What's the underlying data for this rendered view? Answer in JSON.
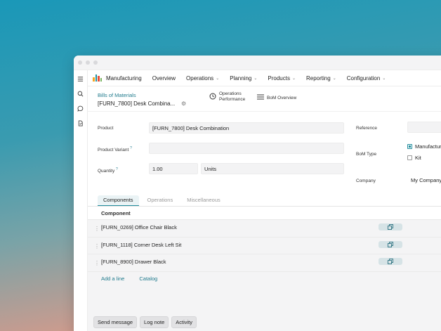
{
  "nav": {
    "app_name": "Manufacturing",
    "items": [
      {
        "label": "Overview",
        "has_menu": false
      },
      {
        "label": "Operations",
        "has_menu": true
      },
      {
        "label": "Planning",
        "has_menu": true
      },
      {
        "label": "Products",
        "has_menu": true
      },
      {
        "label": "Reporting",
        "has_menu": true
      },
      {
        "label": "Configuration",
        "has_menu": true
      }
    ]
  },
  "breadcrumb": "Bills of Materials",
  "record_title": "[FURN_7800] Desk Combina...",
  "smart_buttons": {
    "operations_line1": "Operations",
    "operations_line2": "Performance",
    "bom_overview": "BoM Overview"
  },
  "form": {
    "product_label": "Product",
    "product_value": "[FURN_7800] Desk Combination",
    "variant_label": "Product Variant",
    "variant_help": "?",
    "variant_value": "",
    "quantity_label": "Quantity",
    "quantity_help": "?",
    "quantity_value": "1.00",
    "uom_value": "Units",
    "reference_label": "Reference",
    "reference_value": "",
    "bom_type_label": "BoM Type",
    "bom_type_options": [
      {
        "label": "Manufacture",
        "checked": true
      },
      {
        "label": "Kit",
        "checked": false
      }
    ],
    "company_label": "Company",
    "company_value": "My Company"
  },
  "tabs": [
    "Components",
    "Operations",
    "Miscellaneous"
  ],
  "active_tab": 0,
  "components": {
    "column_header": "Component",
    "rows": [
      "[FURN_0269] Office Chair Black",
      "[FURN_1118] Corner Desk Left Sit",
      "[FURN_8900] Drawer Black"
    ],
    "add_line": "Add a line",
    "catalog": "Catalog"
  },
  "chatter": {
    "send_message": "Send message",
    "log_note": "Log note",
    "activity": "Activity"
  },
  "colors": {
    "accent": "#1f8b9c",
    "link": "#1f7a8c",
    "logo": [
      "#f5a623",
      "#1e90a0",
      "#e8503a",
      "#7bb662"
    ]
  }
}
